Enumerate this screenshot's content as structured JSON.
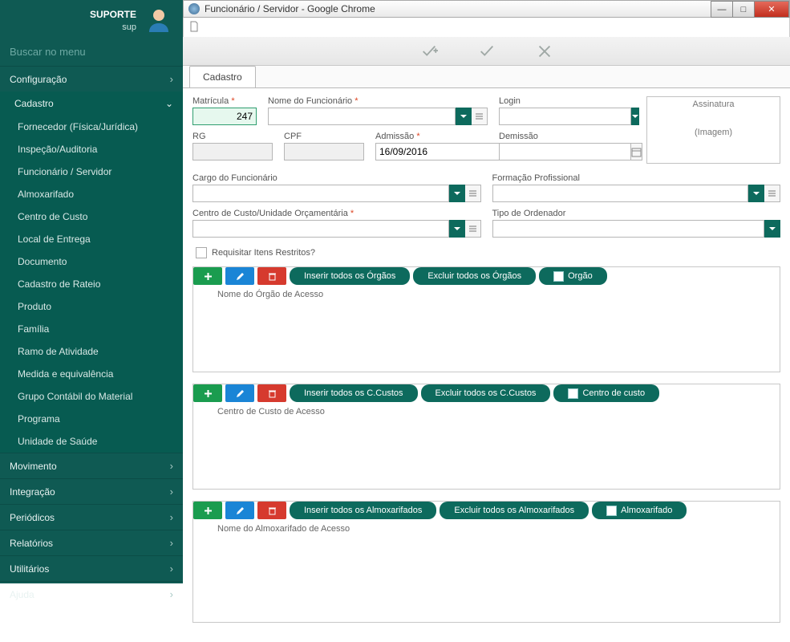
{
  "sidebar": {
    "user_role": "SUPORTE",
    "user_name": "sup",
    "search_placeholder": "Buscar no menu",
    "sections": {
      "configuracao": "Configuração",
      "movimento": "Movimento",
      "integracao": "Integração",
      "periodicos": "Periódicos",
      "relatorios": "Relatórios",
      "utilitarios": "Utilitários",
      "ajuda": "Ajuda"
    },
    "cadastro_label": "Cadastro",
    "cadastro_items": [
      "Fornecedor (Física/Jurídica)",
      "Inspeção/Auditoria",
      "Funcionário / Servidor",
      "Almoxarifado",
      "Centro de Custo",
      "Local de Entrega",
      "Documento",
      "Cadastro de Rateio",
      "Produto",
      "Família",
      "Ramo de Atividade",
      "Medida e equivalência",
      "Grupo Contábil do Material",
      "Programa",
      "Unidade de Saúde"
    ]
  },
  "window": {
    "title": "Funcionário / Servidor - Google Chrome"
  },
  "tabs": {
    "cadastro": "Cadastro"
  },
  "form": {
    "matricula_label": "Matrícula",
    "matricula_value": "247",
    "nome_label": "Nome do Funcionário",
    "login_label": "Login",
    "rg_label": "RG",
    "cpf_label": "CPF",
    "admissao_label": "Admissão",
    "admissao_value": "16/09/2016",
    "demissao_label": "Demissão",
    "cargo_label": "Cargo do Funcionário",
    "formacao_label": "Formação Profissional",
    "centro_label": "Centro de Custo/Unidade Orçamentária",
    "tipo_ord_label": "Tipo de Ordenador",
    "assinatura_label": "Assinatura",
    "assinatura_ph": "(Imagem)",
    "requisitar_label": "Requisitar Itens Restritos?"
  },
  "sections": {
    "orgao": {
      "insert_all": "Inserir todos os Órgãos",
      "delete_all": "Excluir todos os Órgãos",
      "tag": "Orgão",
      "sub": "Nome do Órgão de Acesso"
    },
    "ccusto": {
      "insert_all": "Inserir todos os C.Custos",
      "delete_all": "Excluir todos os C.Custos",
      "tag": "Centro de custo",
      "sub": "Centro de Custo de Acesso"
    },
    "almox": {
      "insert_all": "Inserir todos os Almoxarifados",
      "delete_all": "Excluir todos os Almoxarifados",
      "tag": "Almoxarifado",
      "sub": "Nome do Almoxarifado de Acesso"
    }
  }
}
